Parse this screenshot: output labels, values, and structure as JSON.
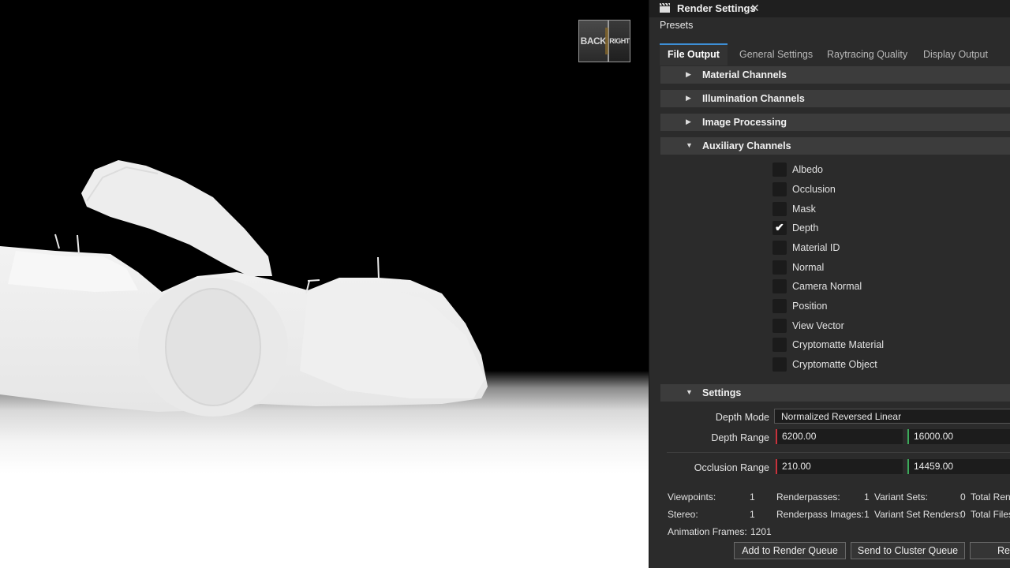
{
  "viewport": {
    "navcube": {
      "back_label": "BACK",
      "right_label": "RIGHT"
    }
  },
  "panel": {
    "title": "Render Settings",
    "close_glyph": "✕",
    "icon": "clapperboard-icon",
    "presets_label": "Presets",
    "tabs": [
      "File Output",
      "General Settings",
      "Raytracing Quality",
      "Display Output"
    ],
    "active_tab": "File Output",
    "sections": [
      {
        "label": "Material Channels",
        "expanded": false
      },
      {
        "label": "Illumination Channels",
        "expanded": false
      },
      {
        "label": "Image Processing",
        "expanded": false
      },
      {
        "label": "Auxiliary Channels",
        "expanded": true
      }
    ],
    "aux_channels": [
      {
        "label": "Albedo",
        "checked": false
      },
      {
        "label": "Occlusion",
        "checked": false
      },
      {
        "label": "Mask",
        "checked": false
      },
      {
        "label": "Depth",
        "checked": true
      },
      {
        "label": "Material ID",
        "checked": false
      },
      {
        "label": "Normal",
        "checked": false
      },
      {
        "label": "Camera Normal",
        "checked": false
      },
      {
        "label": "Position",
        "checked": false
      },
      {
        "label": "View Vector",
        "checked": false
      },
      {
        "label": "Cryptomatte Material",
        "checked": false
      },
      {
        "label": "Cryptomatte Object",
        "checked": false
      }
    ],
    "settings": {
      "header": "Settings",
      "depth_mode_label": "Depth Mode",
      "depth_mode_value": "Normalized Reversed Linear",
      "depth_range_label": "Depth Range",
      "depth_range_min": "6200.00",
      "depth_range_max": "16000.00",
      "occlusion_range_label": "Occlusion Range",
      "occlusion_range_min": "210.00",
      "occlusion_range_max": "14459.00"
    },
    "stats": {
      "viewpoints_label": "Viewpoints:",
      "viewpoints": "1",
      "renderpasses_label": "Renderpasses:",
      "renderpasses": "1",
      "variant_sets_label": "Variant Sets:",
      "variant_sets": "0",
      "total_renders_label": "Total Rend",
      "stereo_label": "Stereo:",
      "stereo": "1",
      "renderpass_images_label": "Renderpass Images:",
      "renderpass_images": "1",
      "variant_set_renders_label": "Variant Set Renders:",
      "variant_set_renders": "0",
      "total_files_label": "Total Files",
      "animation_frames_label": "Animation Frames:",
      "animation_frames": "1201"
    },
    "buttons": {
      "add_to_render_queue": "Add to Render Queue",
      "send_to_cluster_queue": "Send to Cluster Queue",
      "render_partial": "Ren"
    }
  }
}
